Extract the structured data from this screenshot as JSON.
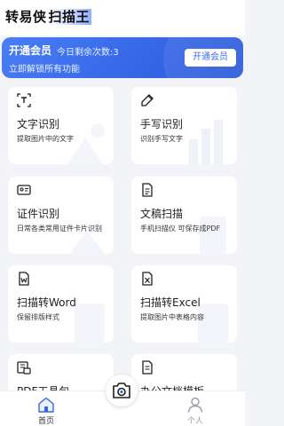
{
  "header": {
    "title_main": "转易侠",
    "title_highlight": "扫描王"
  },
  "vip_banner": {
    "title": "开通会员",
    "quota_text": "今日剩余次数:3",
    "subtitle": "立即解锁所有功能",
    "button_label": "开通会员"
  },
  "features": [
    {
      "title": "文字识别",
      "desc": "提取图片中的文字",
      "icon": "text-recognition-icon"
    },
    {
      "title": "手写识别",
      "desc": "识别手写文字",
      "icon": "handwriting-pen-icon"
    },
    {
      "title": "证件识别",
      "desc": "日常各类常用证件卡片识别",
      "icon": "id-card-icon"
    },
    {
      "title": "文稿扫描",
      "desc": "手机扫描仪 可保存成PDF",
      "icon": "document-scan-icon"
    },
    {
      "title": "扫描转Word",
      "desc": "保留排版样式",
      "icon": "word-icon"
    },
    {
      "title": "扫描转Excel",
      "desc": "提取图片中表格内容",
      "icon": "excel-icon"
    },
    {
      "title": "PDF工具包",
      "desc": "",
      "icon": "pdf-tools-icon"
    },
    {
      "title": "办公文档模板",
      "desc": "",
      "icon": "office-template-icon"
    }
  ],
  "bottom_nav": {
    "home_label": "首页",
    "personal_label": "个人"
  },
  "colors": {
    "accent": "#3566e6",
    "background": "#f2f4f8",
    "card": "#ffffff",
    "icon_stroke": "#1e1e1e",
    "inactive": "#9a9ea6"
  }
}
